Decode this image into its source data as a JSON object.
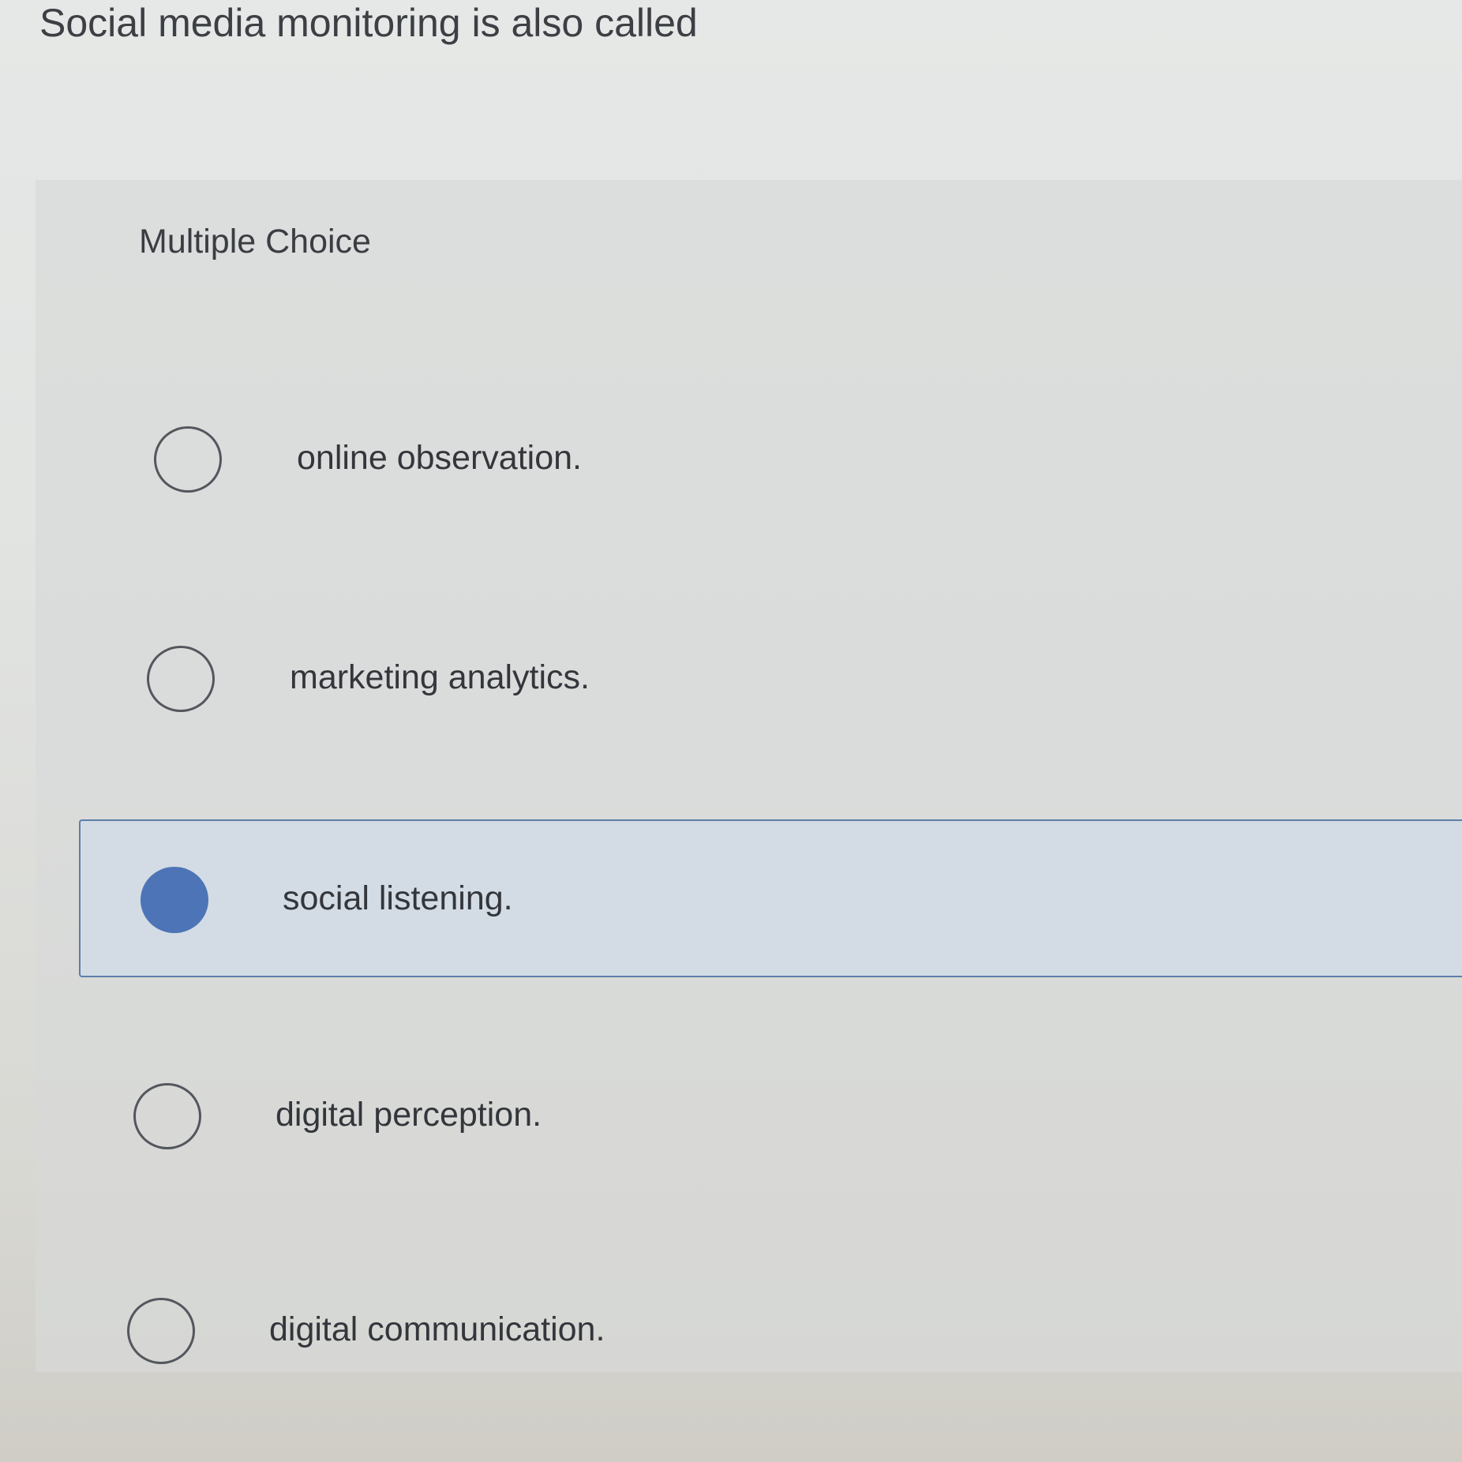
{
  "question": {
    "text": "Social media monitoring is also called"
  },
  "question_type": "Multiple Choice",
  "options": [
    {
      "label": "online observation.",
      "selected": false
    },
    {
      "label": "marketing analytics.",
      "selected": false
    },
    {
      "label": "social listening.",
      "selected": true
    },
    {
      "label": "digital perception.",
      "selected": false
    },
    {
      "label": "digital communication.",
      "selected": false
    }
  ],
  "colors": {
    "selected_fill": "#4d74b6",
    "selected_border": "#5d7fa8",
    "selected_background": "#d3dce4"
  }
}
